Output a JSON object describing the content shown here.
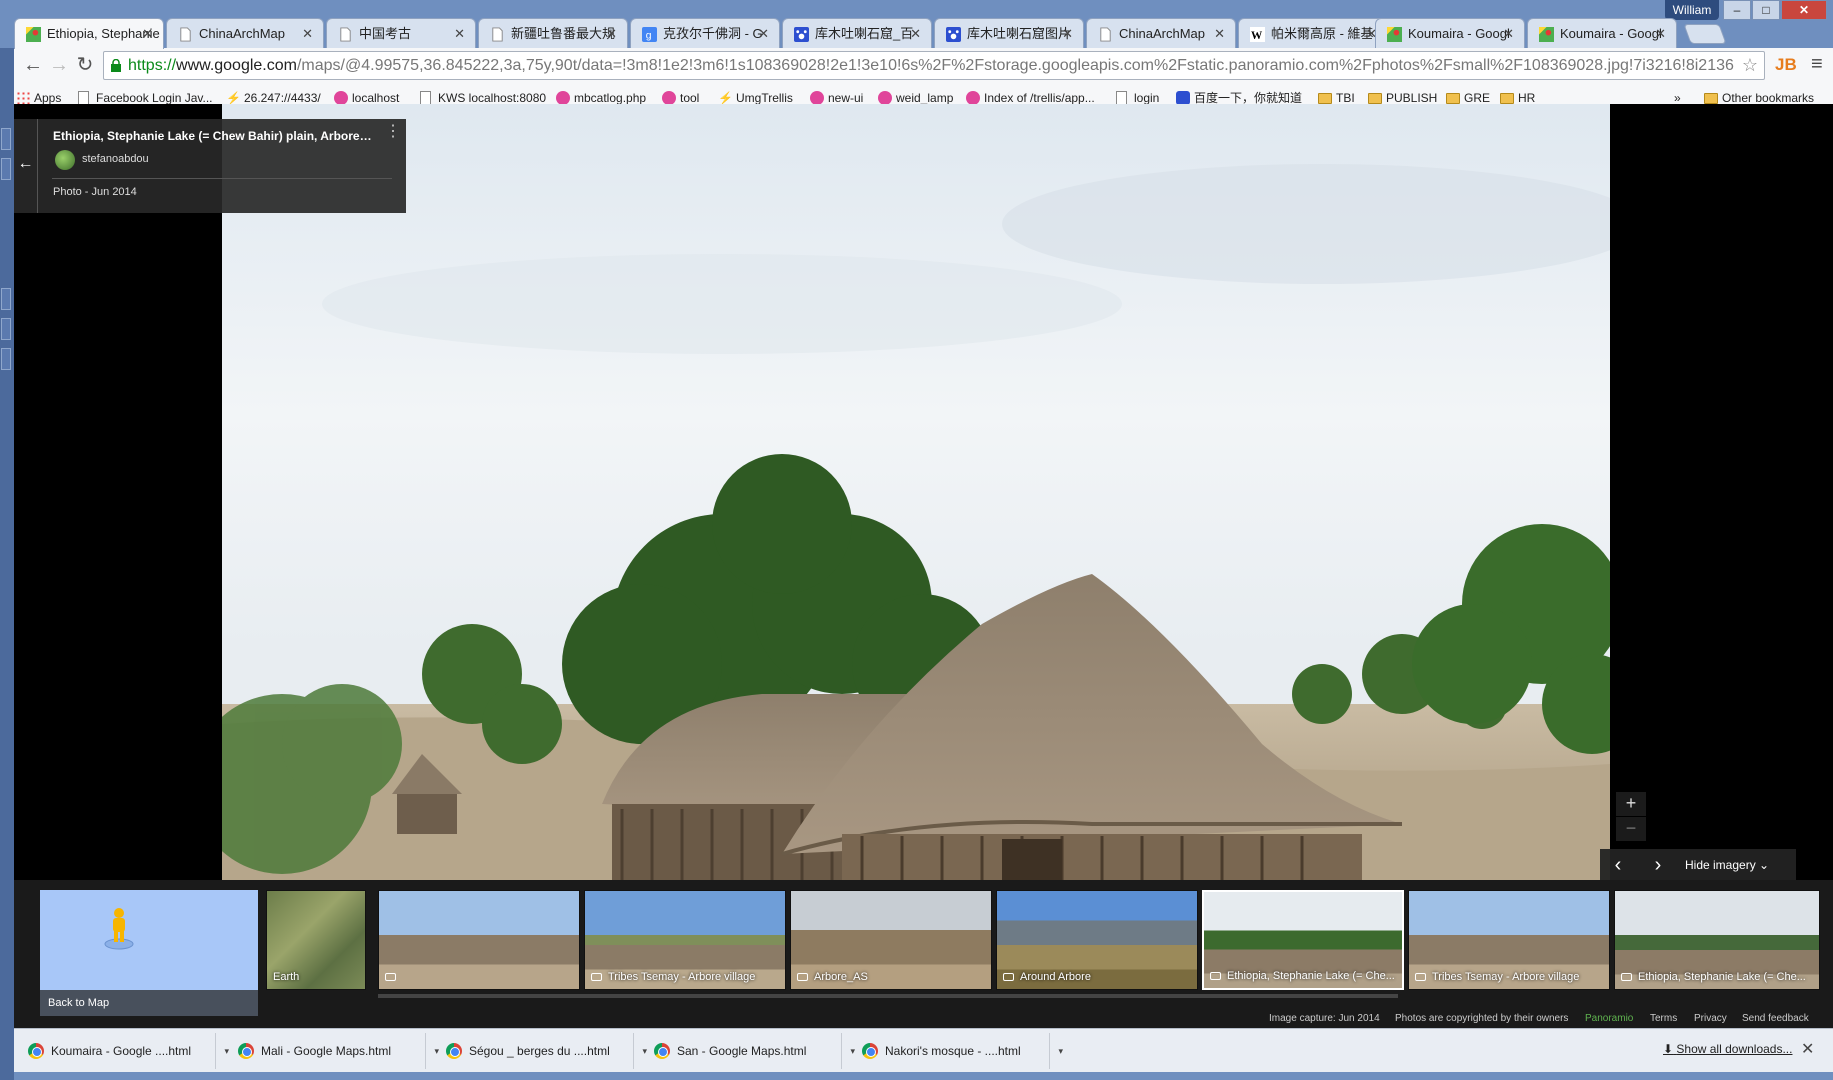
{
  "window": {
    "user": "William",
    "controls": [
      "–",
      "□",
      "✕"
    ]
  },
  "tabs": [
    {
      "label": "Ethiopia, Stephanie",
      "icon": "maps-icon",
      "active": true
    },
    {
      "label": "ChinaArchMap",
      "icon": "page-icon"
    },
    {
      "label": "中国考古",
      "icon": "page-icon"
    },
    {
      "label": "新疆吐鲁番最大规",
      "icon": "page-icon"
    },
    {
      "label": "克孜尔千佛洞 - G",
      "icon": "google-icon"
    },
    {
      "label": "库木吐喇石窟_百",
      "icon": "baidu-icon"
    },
    {
      "label": "库木吐喇石窟图片",
      "icon": "baidu-icon"
    },
    {
      "label": "ChinaArchMap",
      "icon": "page-icon"
    },
    {
      "label": "帕米爾高原 - 維基",
      "icon": "wikipedia-icon"
    },
    {
      "label": "Koumaira - Googl",
      "icon": "maps-icon"
    },
    {
      "label": "Koumaira - Googl",
      "icon": "maps-icon"
    }
  ],
  "address_bar": {
    "protocol": "https://",
    "domain": "www.google.com",
    "path": "/maps/@4.99575,36.845222,3a,75y,90t/data=!3m8!1e2!3m6!1s108369028!2e1!3e10!6s%2F%2Fstorage.googleapis.com%2Fstatic.panoramio.com%2Fphotos%2Fsmall%2F108369028.jpg!7i3216!8i2136"
  },
  "extension_label": "JB",
  "bookmarks": [
    {
      "label": "Apps",
      "icon": "grid"
    },
    {
      "label": "Facebook Login Jav...",
      "icon": "page"
    },
    {
      "label": "26.247://4433/",
      "icon": "lightning"
    },
    {
      "label": "localhost",
      "icon": "pink"
    },
    {
      "label": "KWS localhost:8080",
      "icon": "page"
    },
    {
      "label": "mbcatlog.php",
      "icon": "pink"
    },
    {
      "label": "tool",
      "icon": "pink"
    },
    {
      "label": "UmgTrellis",
      "icon": "lightning"
    },
    {
      "label": "new-ui",
      "icon": "pink"
    },
    {
      "label": "weid_lamp",
      "icon": "pink"
    },
    {
      "label": "Index of /trellis/app...",
      "icon": "pink"
    },
    {
      "label": "login",
      "icon": "page"
    },
    {
      "label": "百度一下，你就知道",
      "icon": "paw"
    },
    {
      "label": "TBI",
      "icon": "folder"
    },
    {
      "label": "PUBLISH",
      "icon": "folder"
    },
    {
      "label": "GRE",
      "icon": "folder"
    },
    {
      "label": "HR",
      "icon": "folder"
    }
  ],
  "bookmarks_overflow": "»",
  "other_bookmarks": "Other bookmarks",
  "info_card": {
    "title": "Ethiopia, Stephanie Lake (= Chew Bahir) plain, Arbore vill...",
    "author": "stefanoabdou",
    "date": "Photo - Jun 2014",
    "menu": "⋮"
  },
  "controls": {
    "zoom_in": "+",
    "zoom_out": "−",
    "prev": "‹",
    "next": "›",
    "hide_imagery": "Hide imagery"
  },
  "filmstrip": {
    "back_to_map": "Back to Map",
    "items": [
      {
        "label": "Earth",
        "camera": false
      },
      {
        "label": "",
        "camera": true
      },
      {
        "label": "Tribes Tsemay - Arbore village",
        "camera": true
      },
      {
        "label": "Arbore_AS",
        "camera": true
      },
      {
        "label": "Around Arbore",
        "camera": true
      },
      {
        "label": "Ethiopia, Stephanie Lake (= Che...",
        "camera": true,
        "selected": true
      },
      {
        "label": "Tribes Tsemay - Arbore village",
        "camera": true
      },
      {
        "label": "Ethiopia, Stephanie Lake (= Che...",
        "camera": true
      }
    ]
  },
  "footer": {
    "capture": "Image capture: Jun 2014",
    "copyright": "Photos are copyrighted by their owners",
    "brand": "Panoramio",
    "terms": "Terms",
    "privacy": "Privacy",
    "feedback": "Send feedback"
  },
  "downloads": [
    {
      "label": "Koumaira - Google ....html"
    },
    {
      "label": "Mali - Google Maps.html"
    },
    {
      "label": "Ségou _ berges du ....html"
    },
    {
      "label": "San - Google Maps.html"
    },
    {
      "label": "Nakori's mosque - ....html"
    }
  ],
  "show_all_downloads": "Show all downloads...",
  "dl_close": "✕"
}
